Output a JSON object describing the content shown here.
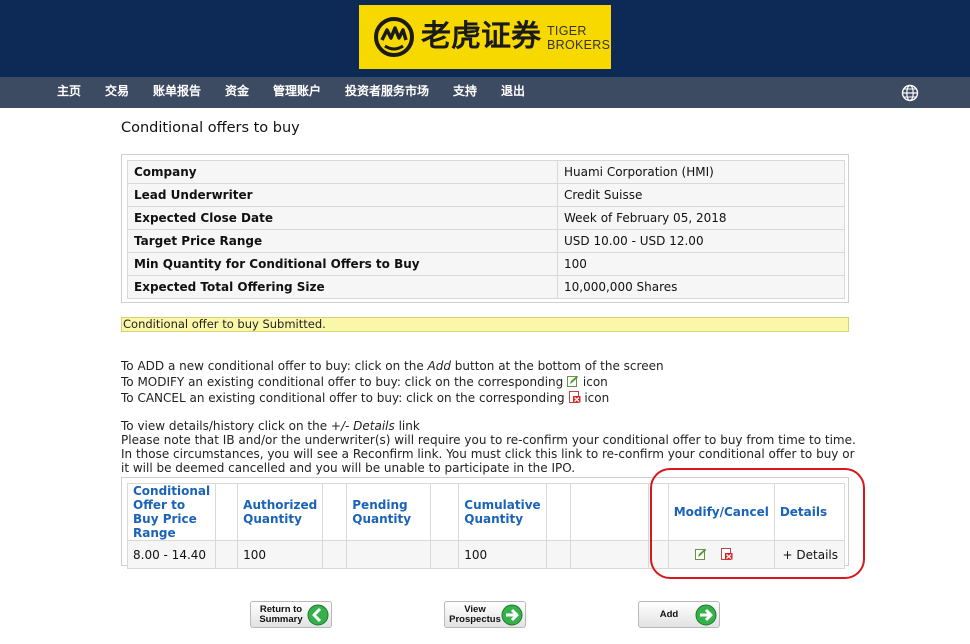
{
  "brand": {
    "logo_cn": "老虎证券",
    "logo_en_line1": "TIGER",
    "logo_en_line2": "BROKERS",
    "colors": {
      "header_bg": "#0d2a57",
      "nav_bg": "#3c4a62",
      "logo_bg": "#f7d900",
      "link_blue": "#1a63b8",
      "annotation_red": "#d7181f"
    }
  },
  "nav": {
    "items": [
      "主页",
      "交易",
      "账单报告",
      "资金",
      "管理账户",
      "投资者服务市场",
      "支持",
      "退出"
    ],
    "globe_icon": "globe-icon"
  },
  "page": {
    "title": "Conditional offers to buy"
  },
  "offering": {
    "rows": [
      {
        "label": "Company",
        "value": "Huami Corporation (HMI)"
      },
      {
        "label": "Lead Underwriter",
        "value": "Credit Suisse"
      },
      {
        "label": "Expected Close Date",
        "value": "Week of February 05, 2018"
      },
      {
        "label": "Target Price Range",
        "value": "USD 10.00 - USD 12.00"
      },
      {
        "label": "Min Quantity for Conditional Offers to Buy",
        "value": "100"
      },
      {
        "label": "Expected Total Offering Size",
        "value": "10,000,000 Shares"
      }
    ]
  },
  "notice": "Conditional offer to buy Submitted.",
  "instructions": {
    "add_pre": "To ADD a new conditional offer to buy: click on the ",
    "add_em": "Add",
    "add_post": " button at the bottom of the screen",
    "modify": "To MODIFY an existing conditional offer to buy: click on the corresponding ",
    "cancel": "To CANCEL an existing conditional offer to buy: click on the corresponding ",
    "icon_word": " icon",
    "details_pre": "To view details/history click on the ",
    "details_em": "+/- Details",
    "details_post": " link",
    "note_line1": "Please note that IB and/or the underwriter(s) will require you to re-confirm your conditional offer to buy from time to time.",
    "note_line2": "In those circumstances, you will see a Reconfirm link. You must click this link to re-confirm your conditional offer to buy or",
    "note_line3": "it will be deemed cancelled and you will be unable to participate in the IPO."
  },
  "offers": {
    "headers": {
      "price_range": "Conditional Offer to Buy Price Range",
      "authorized": "Authorized Quantity",
      "pending": "Pending Quantity",
      "cumulative": "Cumulative Quantity",
      "modify_cancel": "Modify/Cancel",
      "details": "Details"
    },
    "rows": [
      {
        "price_range": "8.00 - 14.40",
        "authorized": "100",
        "pending": "",
        "cumulative": "100",
        "details": "+ Details"
      }
    ]
  },
  "buttons": {
    "return_line1": "Return to",
    "return_line2": "Summary",
    "view_line1": "View",
    "view_line2": "Prospectus",
    "add": "Add"
  }
}
